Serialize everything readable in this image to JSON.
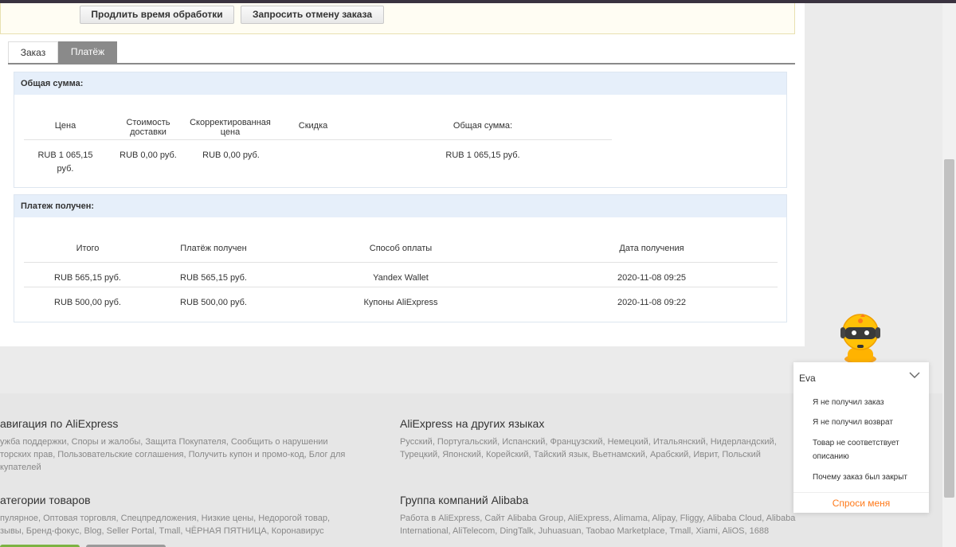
{
  "actions": {
    "extend_label": "Продлить время обработки",
    "cancel_label": "Запросить отмену заказа"
  },
  "tabs": [
    {
      "label": "Заказ",
      "active": false
    },
    {
      "label": "Платёж",
      "active": true
    }
  ],
  "total_panel": {
    "title": "Общая сумма:",
    "headers": {
      "price": "Цена",
      "shipping_l1": "Стоимость",
      "shipping_l2": "доставки",
      "adjusted_l1": "Скорректированная",
      "adjusted_l2": "цена",
      "discount": "Скидка",
      "total": "Общая сумма:"
    },
    "row": {
      "price_l1": "RUB 1 065,15",
      "price_l2": "руб.",
      "shipping": "RUB 0,00 руб.",
      "adjusted": "RUB 0,00 руб.",
      "discount": "",
      "total": "RUB 1 065,15 руб."
    }
  },
  "paid_panel": {
    "title": "Платеж получен:",
    "headers": [
      "Итого",
      "Платёж получен",
      "Способ оплаты",
      "Дата получения"
    ],
    "rows": [
      [
        "RUB 565,15 руб.",
        "RUB 565,15 руб.",
        "Yandex Wallet",
        "2020-11-08 09:25"
      ],
      [
        "RUB 500,00 руб.",
        "RUB 500,00 руб.",
        "Купоны AliExpress",
        "2020-11-08 09:22"
      ]
    ]
  },
  "footer": {
    "nav_title": "авигация по AliExpress",
    "nav_l1": "ужба поддержки, Споры и жалобы, Защита Покупателя, Сообщить о нарушении",
    "nav_l2": "торских прав, Пользовательские соглашения, Получить купон и промо-код, Блог для",
    "nav_l3": "купателей",
    "lang_title": "AliExpress на других языках",
    "lang_l1": "Русский, Португальский, Испанский, Французский, Немецкий, Итальянский, Нидерландский,",
    "lang_l2": "Турецкий, Японский, Корейский, Тайский язык, Вьетнамский, Арабский, Иврит, Польский",
    "cat_title": "атегории товаров",
    "cat_l1": "пулярное, Оптовая торговля, Спецпредложения, Низкие цены, Недорогой товар,",
    "cat_l2": "зывы, Бренд-фокус, Blog, Seller Portal, Tmall, ЧЁРНАЯ ПЯТНИЦА, Коронавирус",
    "group_title": "Группа компаний Alibaba",
    "group_l1": "Работа в AliExpress, Сайт Alibaba Group, AliExpress, Alimama, Alipay, Fliggy, Alibaba Cloud, Alibaba",
    "group_l2": "International, AliTelecom, DingTalk, Juhuasuan, Taobao Marketplace, Tmall, Xiami, AliOS, 1688"
  },
  "chat": {
    "name": "Eva",
    "q1": "Я не получил заказ",
    "q2": "Я не получил возврат",
    "q3": "Товар не соответствует описанию",
    "q4": "Почему заказ был закрыт",
    "ask_label": "Спроси меня"
  },
  "colors": {
    "accent_orange": "#ff7a1a",
    "panel_header": "#e6effa",
    "tab_active": "#8a8a8a"
  }
}
